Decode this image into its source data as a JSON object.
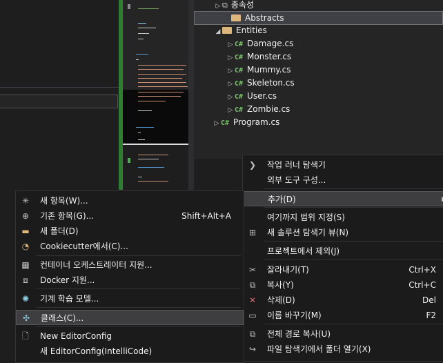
{
  "explorer": {
    "items": [
      {
        "label": "종속성",
        "kind": "deps",
        "expander": "▷"
      },
      {
        "label": "Abstracts",
        "kind": "folder",
        "expander": ""
      },
      {
        "label": "Entities",
        "kind": "folder-open",
        "expander": "◢"
      },
      {
        "label": "Damage.cs",
        "kind": "cs",
        "expander": "▷"
      },
      {
        "label": "Monster.cs",
        "kind": "cs",
        "expander": "▷"
      },
      {
        "label": "Mummy.cs",
        "kind": "cs",
        "expander": "▷"
      },
      {
        "label": "Skeleton.cs",
        "kind": "cs",
        "expander": "▷"
      },
      {
        "label": "User.cs",
        "kind": "cs",
        "expander": "▷"
      },
      {
        "label": "Zombie.cs",
        "kind": "cs",
        "expander": "▷"
      },
      {
        "label": "Program.cs",
        "kind": "cs",
        "expander": "▷"
      }
    ],
    "cs_badge": "C#"
  },
  "context_menu": {
    "items": [
      {
        "label": "작업 러너 탐색기",
        "shortcut": "",
        "icon": "chevron-right-icon",
        "glyph": "❯"
      },
      {
        "label": "외부 도구 구성...",
        "shortcut": "",
        "icon": "",
        "glyph": ""
      },
      {
        "label": "추가(D)",
        "shortcut": "",
        "icon": "",
        "glyph": ""
      },
      {
        "label": "여기까지 범위 지정(S)",
        "shortcut": "",
        "icon": "",
        "glyph": ""
      },
      {
        "label": "새 솔루션 탐색기 뷰(N)",
        "shortcut": "",
        "icon": "new-view-icon",
        "glyph": "⊞"
      },
      {
        "label": "프로젝트에서 제외(J)",
        "shortcut": "",
        "icon": "",
        "glyph": ""
      },
      {
        "label": "잘라내기(T)",
        "shortcut": "Ctrl+X",
        "icon": "scissors-icon",
        "glyph": "✂"
      },
      {
        "label": "복사(Y)",
        "shortcut": "Ctrl+C",
        "icon": "copy-icon",
        "glyph": "⧉"
      },
      {
        "label": "삭제(D)",
        "shortcut": "Del",
        "icon": "delete-icon",
        "glyph": "✕"
      },
      {
        "label": "이름 바꾸기(M)",
        "shortcut": "F2",
        "icon": "rename-icon",
        "glyph": "▭"
      },
      {
        "label": "전체 경로 복사(U)",
        "shortcut": "",
        "icon": "copy-path-icon",
        "glyph": "⧉"
      },
      {
        "label": "파일 탐색기에서 폴더 열기(X)",
        "shortcut": "",
        "icon": "open-folder-icon",
        "glyph": "↪"
      }
    ],
    "submenu_arrow": "▶"
  },
  "add_submenu": {
    "items": [
      {
        "label": "새 항목(W)...",
        "shortcut": "",
        "icon": "new-item-icon",
        "glyph": "✳"
      },
      {
        "label": "기존 항목(G)...",
        "shortcut": "Shift+Alt+A",
        "icon": "existing-item-icon",
        "glyph": "⊕"
      },
      {
        "label": "새 폴더(D)",
        "shortcut": "",
        "icon": "new-folder-icon",
        "glyph": "▬"
      },
      {
        "label": "Cookiecutter에서(C)...",
        "shortcut": "",
        "icon": "cookiecutter-icon",
        "glyph": "◔"
      },
      {
        "label": "컨테이너 오케스트레이터 지원...",
        "shortcut": "",
        "icon": "container-icon",
        "glyph": "▦"
      },
      {
        "label": "Docker 지원...",
        "shortcut": "",
        "icon": "docker-icon",
        "glyph": "⧈"
      },
      {
        "label": "기계 학습 모델...",
        "shortcut": "",
        "icon": "ml-model-icon",
        "glyph": "✺"
      },
      {
        "label": "클래스(C)...",
        "shortcut": "",
        "icon": "class-icon",
        "glyph": "✣"
      },
      {
        "label": "New EditorConfig",
        "shortcut": "",
        "icon": "editorconfig-icon",
        "glyph": "🗋"
      },
      {
        "label": "새 EditorConfig(IntelliCode)",
        "shortcut": "",
        "icon": "editorconfig-intellicode-icon",
        "glyph": ""
      }
    ]
  },
  "colors": {
    "accent_green": "#2e7d32",
    "cs_green": "#79c36a",
    "folder_yellow": "#dcb67a",
    "delete_red": "#d16969"
  }
}
